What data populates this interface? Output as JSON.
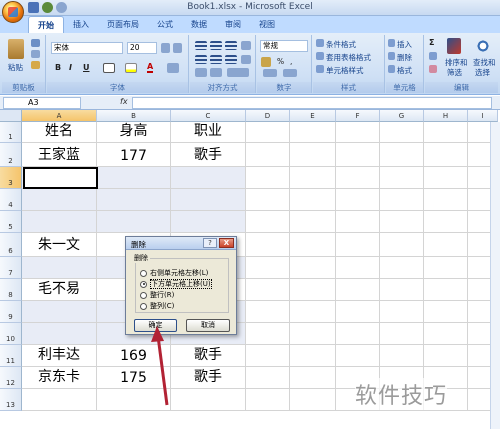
{
  "window": {
    "title": "Book1.xlsx - Microsoft Excel"
  },
  "ribbon": {
    "tabs": [
      "开始",
      "插入",
      "页面布局",
      "公式",
      "数据",
      "审阅",
      "视图"
    ],
    "active_tab": "开始",
    "clipboard": {
      "paste_label": "粘贴",
      "group_label": "剪贴板"
    },
    "font": {
      "name": "宋体",
      "size": "20",
      "group_label": "字体"
    },
    "alignment": {
      "group_label": "对齐方式"
    },
    "number": {
      "format": "常规",
      "group_label": "数字"
    },
    "styles": {
      "conditional": "条件格式",
      "table": "套用表格格式",
      "cell": "单元格样式",
      "group_label": "样式"
    },
    "cells": {
      "insert": "插入",
      "delete": "删除",
      "format": "格式",
      "group_label": "单元格"
    },
    "editing": {
      "sort": "排序和",
      "sort2": "筛选",
      "find": "查找和",
      "find2": "选择",
      "group_label": "编辑"
    }
  },
  "formula_bar": {
    "name_box": "A3",
    "fx": "fx",
    "content": ""
  },
  "sheet": {
    "columns": [
      "A",
      "B",
      "C",
      "D",
      "E",
      "F",
      "G",
      "H",
      "I"
    ],
    "rows": [
      "1",
      "2",
      "3",
      "4",
      "5",
      "6",
      "7",
      "8",
      "9",
      "10",
      "11",
      "12",
      "13"
    ],
    "cells": {
      "A1": "姓名",
      "B1": "身高",
      "C1": "职业",
      "A2": "王家蓝",
      "B2": "177",
      "C2": "歌手",
      "A6": "朱一文",
      "B6": "1",
      "A8": "毛不易",
      "B8": "1",
      "A11": "利丰达",
      "B11": "169",
      "C11": "歌手",
      "A12": "京东卡",
      "B12": "175",
      "C12": "歌手"
    }
  },
  "dialog": {
    "title": "删除",
    "help": "?",
    "close": "X",
    "group_label": "删除",
    "options": [
      {
        "label": "右侧单元格左移(L)",
        "selected": false
      },
      {
        "label": "下方单元格上移(U)",
        "selected": true
      },
      {
        "label": "整行(R)",
        "selected": false
      },
      {
        "label": "整列(C)",
        "selected": false
      }
    ],
    "ok": "确定",
    "cancel": "取消"
  },
  "watermark": "软件技巧",
  "colors": {
    "ribbon": "#cfe0f5",
    "selection_shade": "#e8ecf6",
    "arrow": "#b22234"
  }
}
